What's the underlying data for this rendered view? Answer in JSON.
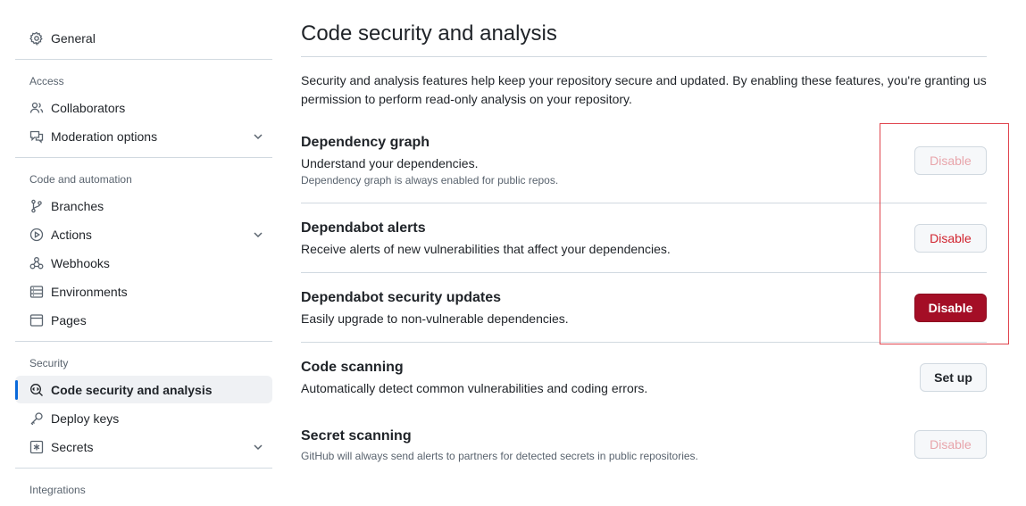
{
  "sidebar": {
    "general": "General",
    "groups": {
      "access": "Access",
      "code_automation": "Code and automation",
      "security": "Security",
      "integrations": "Integrations"
    },
    "items": {
      "collaborators": "Collaborators",
      "moderation": "Moderation options",
      "branches": "Branches",
      "actions": "Actions",
      "webhooks": "Webhooks",
      "environments": "Environments",
      "pages": "Pages",
      "code_security": "Code security and analysis",
      "deploy_keys": "Deploy keys",
      "secrets": "Secrets"
    },
    "active_item": "Code security and analysis"
  },
  "main": {
    "title": "Code security and analysis",
    "intro": "Security and analysis features help keep your repository secure and updated. By enabling these features, you're granting us permission to perform read-only analysis on your repository.",
    "features": {
      "dependency_graph": {
        "title": "Dependency graph",
        "description": "Understand your dependencies.",
        "note": "Dependency graph is always enabled for public repos.",
        "button": "Disable"
      },
      "dependabot_alerts": {
        "title": "Dependabot alerts",
        "description": "Receive alerts of new vulnerabilities that affect your dependencies.",
        "button": "Disable"
      },
      "dependabot_security_updates": {
        "title": "Dependabot security updates",
        "description": "Easily upgrade to non-vulnerable dependencies.",
        "button": "Disable"
      },
      "code_scanning": {
        "title": "Code scanning",
        "description": "Automatically detect common vulnerabilities and coding errors.",
        "button": "Set up"
      },
      "secret_scanning": {
        "title": "Secret scanning",
        "note": "GitHub will always send alerts to partners for detected secrets in public repositories.",
        "button": "Disable"
      }
    }
  },
  "colors": {
    "accent": "#0969da",
    "danger": "#d1242f",
    "danger_solid": "#a40e26",
    "highlight": "#e0454e"
  }
}
